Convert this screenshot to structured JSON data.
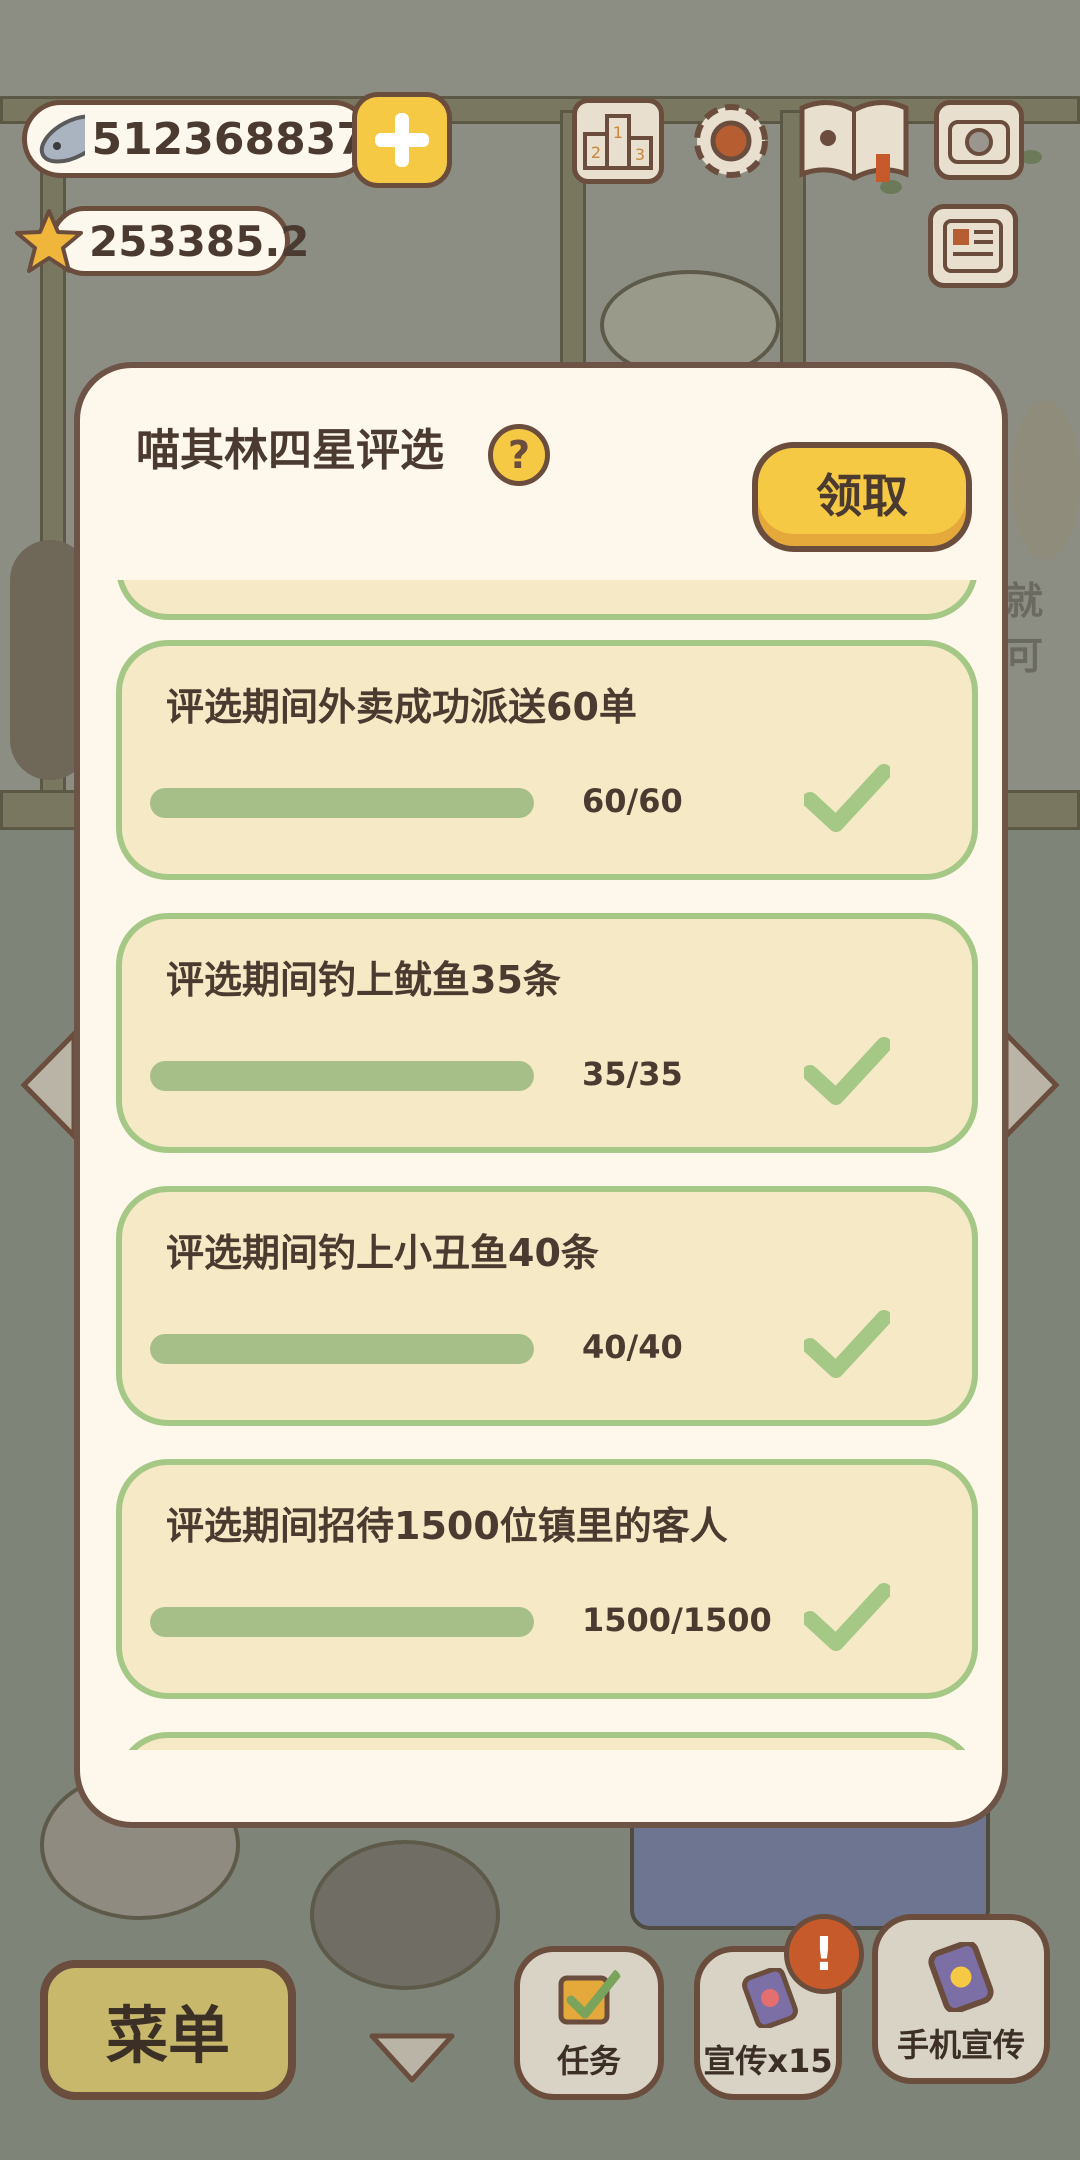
{
  "hud": {
    "fish_currency": "512368837",
    "star_currency": "253385.2"
  },
  "modal": {
    "title": "喵其林四星评选",
    "claim_label": "领取",
    "tasks": [
      {
        "title": "评选期间外卖成功派送60单",
        "progress": "60/60",
        "fill": 1.0,
        "completed": true
      },
      {
        "title": "评选期间钓上鱿鱼35条",
        "progress": "35/35",
        "fill": 1.0,
        "completed": true
      },
      {
        "title": "评选期间钓上小丑鱼40条",
        "progress": "40/40",
        "fill": 1.0,
        "completed": true
      },
      {
        "title": "评选期间招待1500位镇里的客人",
        "progress": "1500/1500",
        "fill": 1.0,
        "completed": true
      }
    ]
  },
  "background_text": "就可",
  "bottom_bar": {
    "menu_label": "菜单",
    "tasks_label": "任务",
    "promo_label": "宣传x15",
    "phone_promo_label": "手机宣传",
    "alert_mark": "!"
  },
  "icons": [
    "fish-icon",
    "plus-icon",
    "star-icon",
    "ranking-icon",
    "settings-icon",
    "guidebook-icon",
    "camera-icon",
    "newspaper-icon",
    "help-icon",
    "check-icon",
    "down-arrow-icon"
  ],
  "colors": {
    "accent_yellow": "#f6c945",
    "card_border_green": "#a6c887",
    "card_fill": "#f5e9c6",
    "check_green": "#a6c887",
    "outline_brown": "#6a4d3c"
  }
}
